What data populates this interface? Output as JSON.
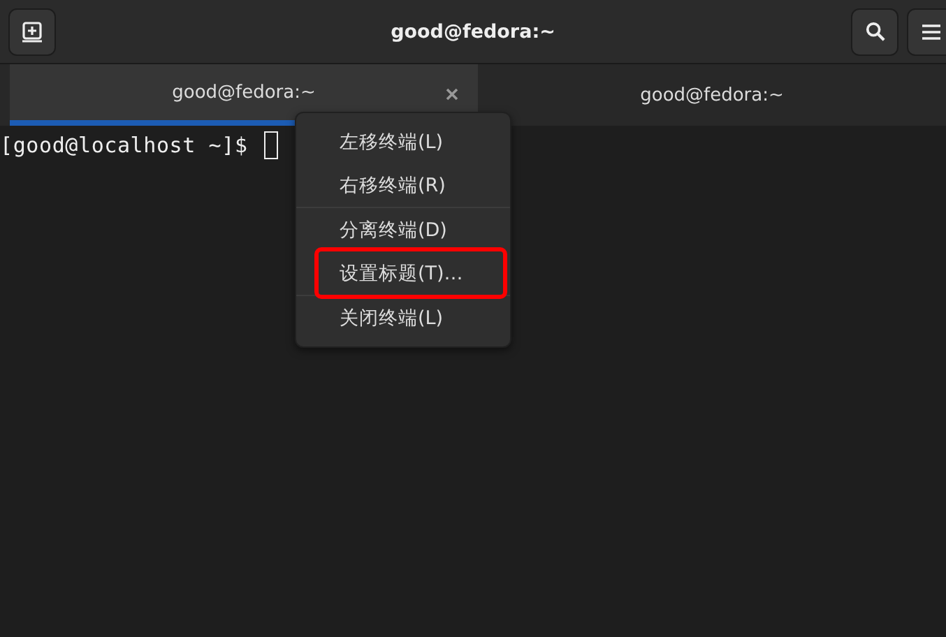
{
  "window": {
    "title": "good@fedora:~"
  },
  "tabs": [
    {
      "label": "good@fedora:~",
      "selected": true,
      "closable": true
    },
    {
      "label": "good@fedora:~",
      "selected": false,
      "closable": false
    }
  ],
  "terminal": {
    "prompt": "[good@localhost ~]$"
  },
  "context_menu": {
    "items": [
      {
        "label": "左移终端(L)",
        "separator_after": false,
        "highlighted": false
      },
      {
        "label": "右移终端(R)",
        "separator_after": true,
        "highlighted": false
      },
      {
        "label": "分离终端(D)",
        "separator_after": false,
        "highlighted": false
      },
      {
        "label": "设置标题(T)…",
        "separator_after": true,
        "highlighted": true
      },
      {
        "label": "关闭终端(L)",
        "separator_after": false,
        "highlighted": false
      }
    ]
  }
}
